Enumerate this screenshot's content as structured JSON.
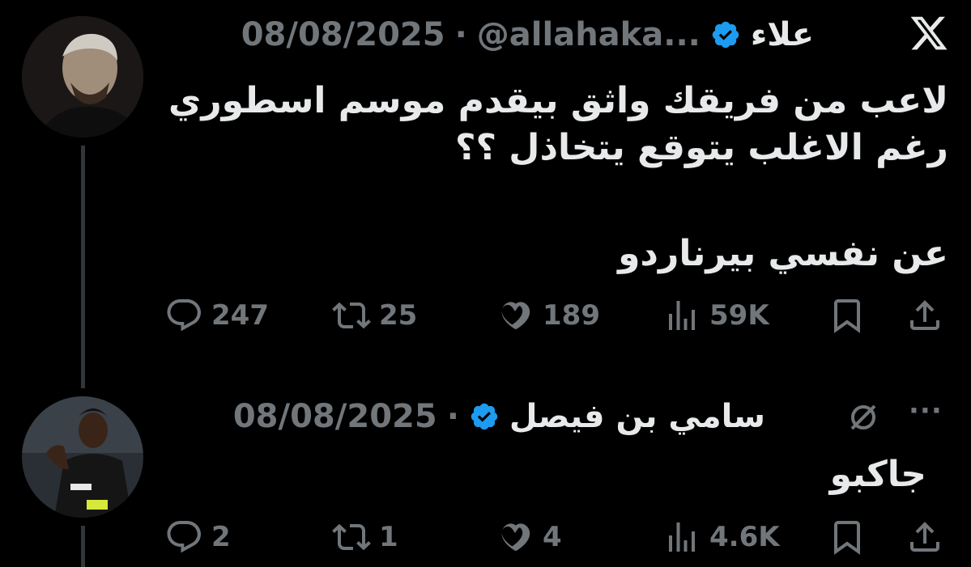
{
  "tweets": [
    {
      "author_name": "علاء",
      "handle": "@allahaka...",
      "dot": "·",
      "date": "08/08/2025",
      "text_lines": [
        "لاعب من فريقك واثق بيقدم موسم اسطوري",
        "رغم الاغلب يتوقع يتخاذل ؟؟"
      ],
      "text_line_extra": "عن نفسي بيرناردو",
      "stats": {
        "replies": "247",
        "reposts": "25",
        "likes": "189",
        "views": "59K"
      }
    },
    {
      "author_name": "سامي بن فيصل",
      "dot": "·",
      "date": "08/08/2025",
      "text": "جاكبو",
      "more": "···",
      "stats": {
        "replies": "2",
        "reposts": "1",
        "likes": "4",
        "views": "4.6K"
      }
    }
  ],
  "icons": {
    "brand": "x-logo-icon",
    "verified_color": "#1d9bf0",
    "muted_color": "#71767b"
  }
}
